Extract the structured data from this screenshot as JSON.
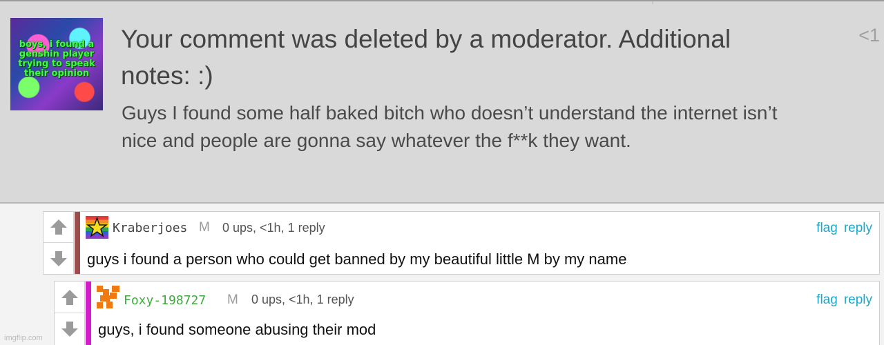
{
  "notice": {
    "title": "Your comment was deleted by a moderator. Additional notes: :)",
    "count": "<1",
    "body": "Guys I found some half baked bitch who doesn’t understand the internet isn’t nice and people are gonna say whatever the f**k they want.",
    "avatar_text": "boys, i found a genshin player trying to speak their opinion"
  },
  "comments": [
    {
      "username": "Kraberjoes",
      "mod_badge": "M",
      "meta": "0 ups, <1h, 1 reply",
      "flag": "flag",
      "reply": "reply",
      "text": "guys i found a person who could get banned by my beautiful little M by my name",
      "stripe_color": "#9b4c4c",
      "username_color": "#444444"
    },
    {
      "username": "Foxy-198727",
      "mod_badge": "M",
      "meta": "0 ups, <1h, 1 reply",
      "flag": "flag",
      "reply": "reply",
      "text": "guys, i found someone abusing their mod",
      "stripe_color": "#d21ec8",
      "username_color": "#3cab3c"
    }
  ],
  "watermark": "imgflip.com"
}
